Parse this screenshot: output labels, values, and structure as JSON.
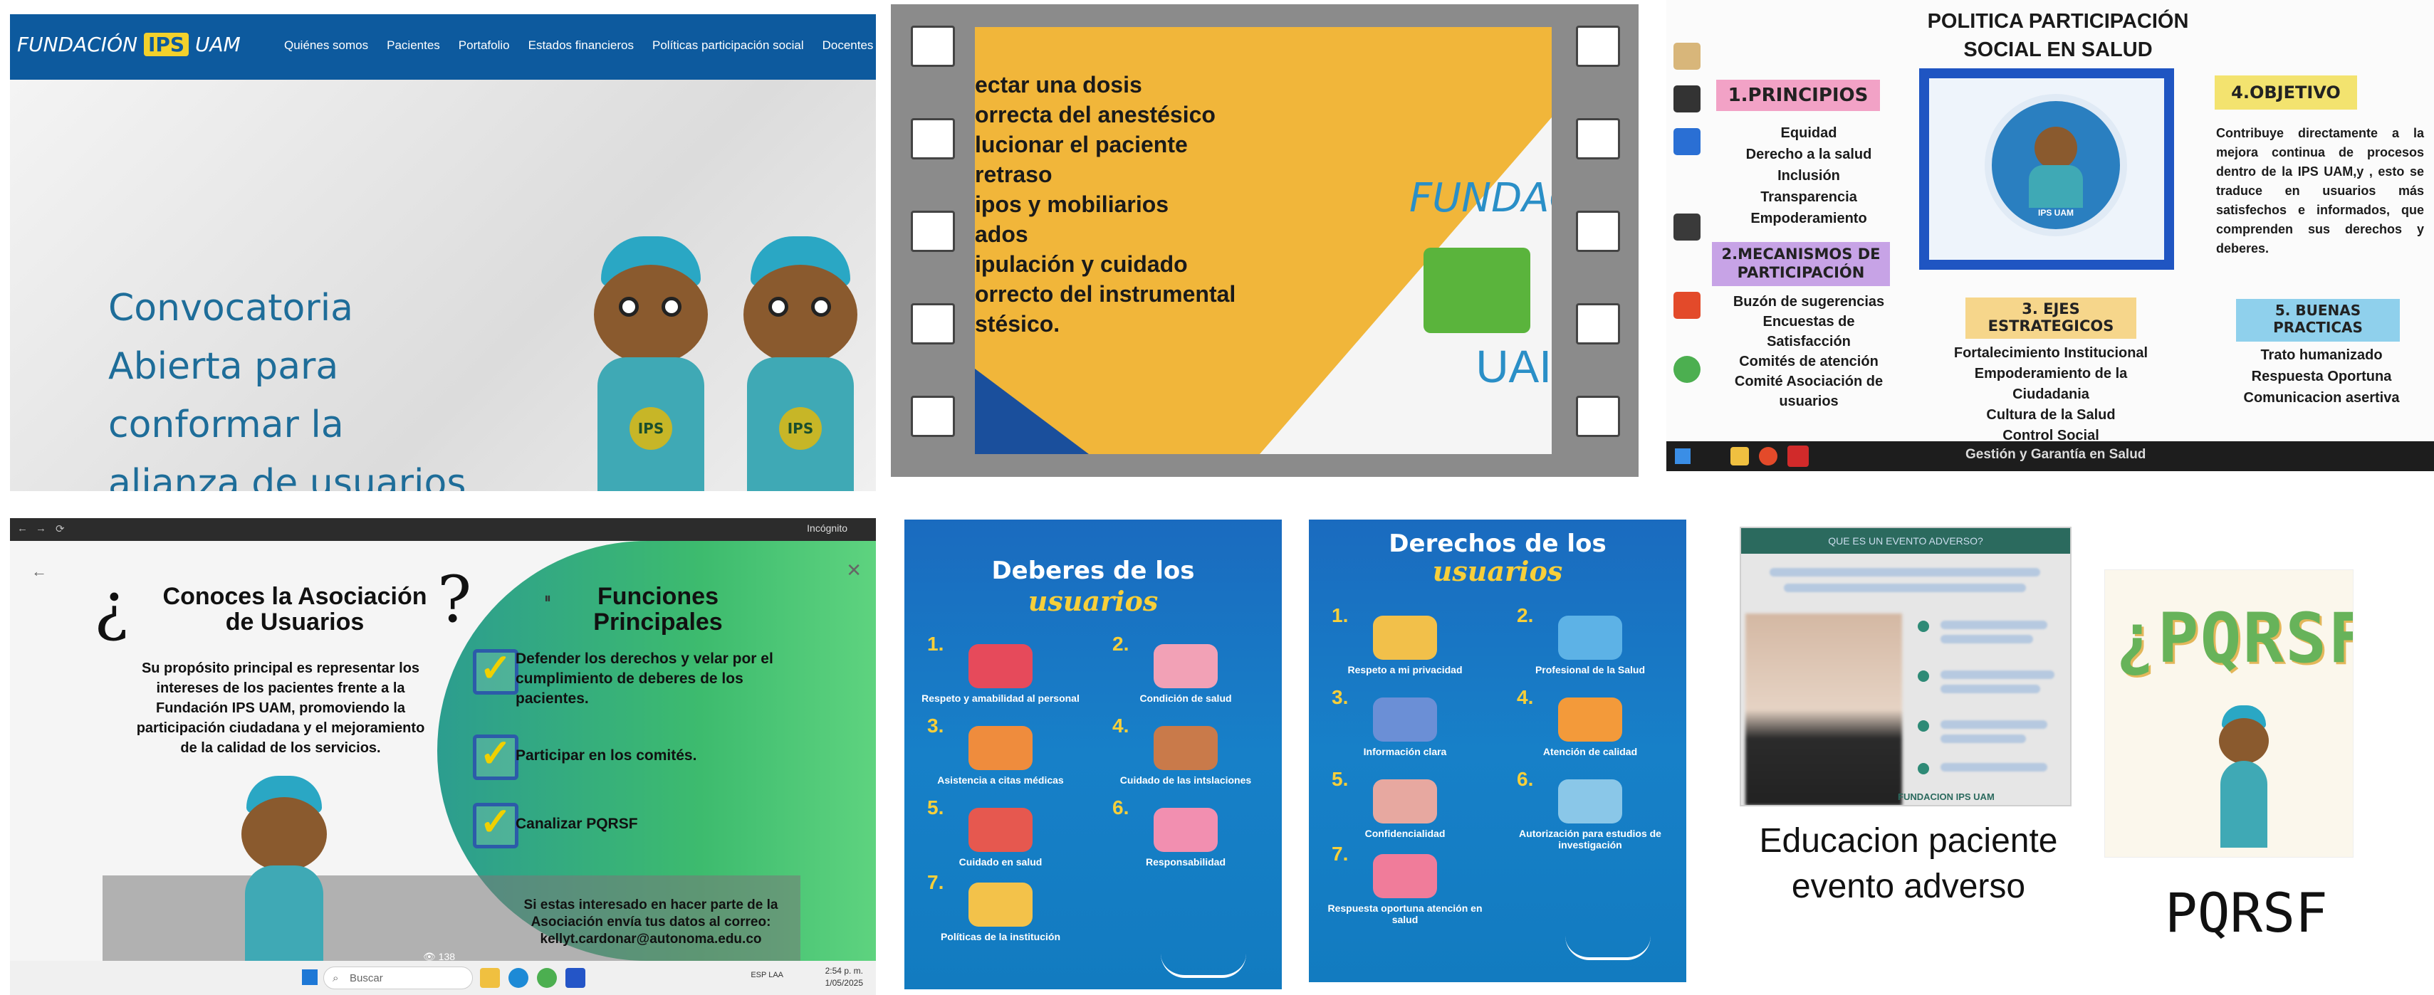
{
  "panel_website": {
    "logo": "FUNDACIÓN IPS UAM",
    "logo_parts": {
      "left": "FUNDACIÓN",
      "mid": "IPS",
      "right": "UAM"
    },
    "nav": [
      "Quiénes somos",
      "Pacientes",
      "Portafolio",
      "Estados financieros",
      "Políticas participación social",
      "Docentes y Estudiantes"
    ],
    "hero_title": "Convocatoria Abierta para conformar la alianza de usuarios",
    "badge": "IPS"
  },
  "panel_video": {
    "lines": "ectar una dosis\norrecta del anestésico\nlucionar el paciente\nretraso\nipos y mobiliarios\nados\nipulación y cuidado\norrecto del instrumental\nstésico.",
    "brand": "FUNDAC",
    "brand_bottom": "UAI"
  },
  "panel_infographic": {
    "title": "POLITICA PARTICIPACIÓN SOCIAL EN SALUD",
    "principios_tag": "1.PRINCIPIOS",
    "principios": [
      "Equidad",
      "Derecho a la salud",
      "Inclusión",
      "Transparencia",
      "Empoderamiento"
    ],
    "mecanismos_tag": "2.MECANISMOS DE PARTICIPACIÓN",
    "mecanismos": [
      "Buzón de sugerencias",
      "Encuestas de Satisfacción",
      "Comités de atención",
      "Comité Asociación de usuarios"
    ],
    "ejes_tag": "3. EJES ESTRATEGICOS",
    "ejes": [
      "Fortalecimiento Institucional",
      "Empoderamiento de la Ciudadania",
      "Cultura de la Salud",
      "Control Social"
    ],
    "objetivo_tag": "4.OBJETIVO",
    "objetivo_text": "Contribuye directamente a la mejora continua de procesos dentro de la IPS UAM,y , esto se traduce en usuarios más satisfechos e informados, que comprenden sus derechos y deberes.",
    "buenas_tag": "5. BUENAS PRACTICAS",
    "buenas": [
      "Trato humanizado",
      "Respuesta Oportuna",
      "Comunicacion asertiva"
    ],
    "center_caption": "IPS UAM",
    "taskbar_text": "Gestión y Garantía en Salud"
  },
  "panel_browser": {
    "incognito": "Incógnito",
    "title_left": "Conoces la Asociación de Usuarios",
    "title_right": "Funciones Principales",
    "purpose": "Su propósito principal es representar los intereses de los pacientes  frente a la Fundación IPS UAM, promoviendo la participación ciudadana y el mejoramiento de la calidad de los servicios.",
    "functions": [
      "Defender los derechos y velar por el cumplimiento de deberes de los pacientes.",
      "Participar en los comités.",
      "Canalizar PQRSF"
    ],
    "contact": "Si estas interesado en hacer parte de la Asociación envía tus datos al correo: kellyt.cardonar@autonoma.edu.co",
    "views": "138",
    "search": "Buscar",
    "time": "2:54 p. m.",
    "date": "1/05/2025",
    "lang": "ESP LAA"
  },
  "poster_deberes": {
    "title": "Deberes de los",
    "title2": "usuarios",
    "items": [
      {
        "n": "1.",
        "label": "Respeto y amabilidad al personal",
        "color": "#e64a5b"
      },
      {
        "n": "2.",
        "label": "Condición de salud",
        "color": "#f2a1b6"
      },
      {
        "n": "3.",
        "label": "Asistencia a citas médicas",
        "color": "#ef8c3d"
      },
      {
        "n": "4.",
        "label": "Cuidado de las intslaciones",
        "color": "#c97a4a"
      },
      {
        "n": "5.",
        "label": "Cuidado en salud",
        "color": "#e6584f"
      },
      {
        "n": "6.",
        "label": "Responsabilidad",
        "color": "#f28fb0"
      },
      {
        "n": "7.",
        "label": "Políticas de la institución",
        "color": "#f3c24a"
      }
    ]
  },
  "poster_derechos": {
    "title": "Derechos de los",
    "title2": "usuarios",
    "items": [
      {
        "n": "1.",
        "label": "Respeto a mi privacidad",
        "color": "#f2c04a"
      },
      {
        "n": "2.",
        "label": "Profesional de la Salud",
        "color": "#5db2e6"
      },
      {
        "n": "3.",
        "label": "Información clara",
        "color": "#6b8fd6"
      },
      {
        "n": "4.",
        "label": "Atención de calidad",
        "color": "#f39a3a"
      },
      {
        "n": "5.",
        "label": "Confidencialidad",
        "color": "#e7a8a0"
      },
      {
        "n": "6.",
        "label": "Autorización para estudios de investigación",
        "color": "#8ac7e8"
      },
      {
        "n": "7.",
        "label": "Respuesta oportuna atención en salud",
        "color": "#f07c9a"
      }
    ]
  },
  "panel_educacion": {
    "header": "QUE ES UN EVENTO ADVERSO?",
    "footer": "FUNDACION IPS UAM",
    "caption": "Educacion paciente evento adverso"
  },
  "panel_pqrsf": {
    "logo_text": "¿PQRSF?",
    "caption": "PQRSF"
  }
}
